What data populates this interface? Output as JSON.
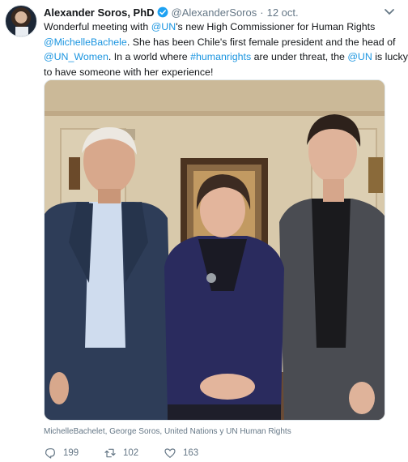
{
  "tweet": {
    "author_name": "Alexander Soros, PhD",
    "handle": "@AlexanderSoros",
    "separator": "·",
    "date": "12 oct.",
    "text_lines": [
      [
        {
          "t": "Wonderful meeting with ",
          "link": false
        },
        {
          "t": "@UN",
          "link": true
        },
        {
          "t": "'s new High Commissioner for Human Rights",
          "link": false
        }
      ],
      [
        {
          "t": "@MichelleBachele",
          "link": true
        },
        {
          "t": ". She has been Chile's first female president and the head of",
          "link": false
        }
      ],
      [
        {
          "t": "@UN_Women",
          "link": true
        },
        {
          "t": ". In a world where ",
          "link": false
        },
        {
          "t": "#humanrights",
          "link": true
        },
        {
          "t": " are under threat, the ",
          "link": false
        },
        {
          "t": "@UN",
          "link": true
        },
        {
          "t": " is lucky",
          "link": false
        }
      ],
      [
        {
          "t": "to have someone with her experience!",
          "link": false
        }
      ]
    ],
    "photo_tags": "MichelleBachelet, George Soros, United Nations y UN Human Rights",
    "actions": {
      "replies": "199",
      "retweets": "102",
      "likes": "163"
    }
  },
  "colors": {
    "link": "#1b95e0",
    "muted": "#657786",
    "verified": "#1da1f2"
  },
  "icons": [
    "verified-badge-icon",
    "chevron-down-icon",
    "reply-icon",
    "retweet-icon",
    "like-icon"
  ]
}
